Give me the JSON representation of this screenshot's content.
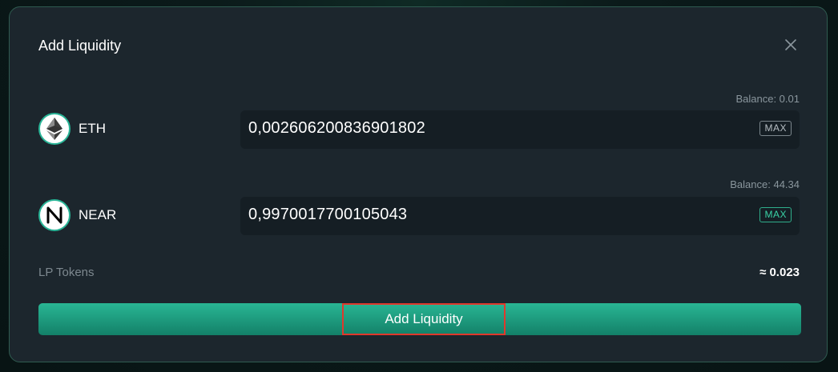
{
  "modal": {
    "title": "Add Liquidity",
    "close_icon": "close-icon"
  },
  "tokens": [
    {
      "symbol": "ETH",
      "icon": "ethereum-icon",
      "balance": "Balance: 0.01",
      "amount": "0,002606200836901802",
      "max_label": "MAX"
    },
    {
      "symbol": "NEAR",
      "icon": "near-icon",
      "balance": "Balance: 44.34",
      "amount": "0,9970017700105043",
      "max_label": "MAX"
    }
  ],
  "lp": {
    "label": "LP Tokens",
    "value": "≈ 0.023"
  },
  "submit": {
    "label": "Add Liquidity"
  },
  "colors": {
    "accent": "#29b694",
    "modal_bg": "#1c262d",
    "highlight": "#e0392c"
  }
}
